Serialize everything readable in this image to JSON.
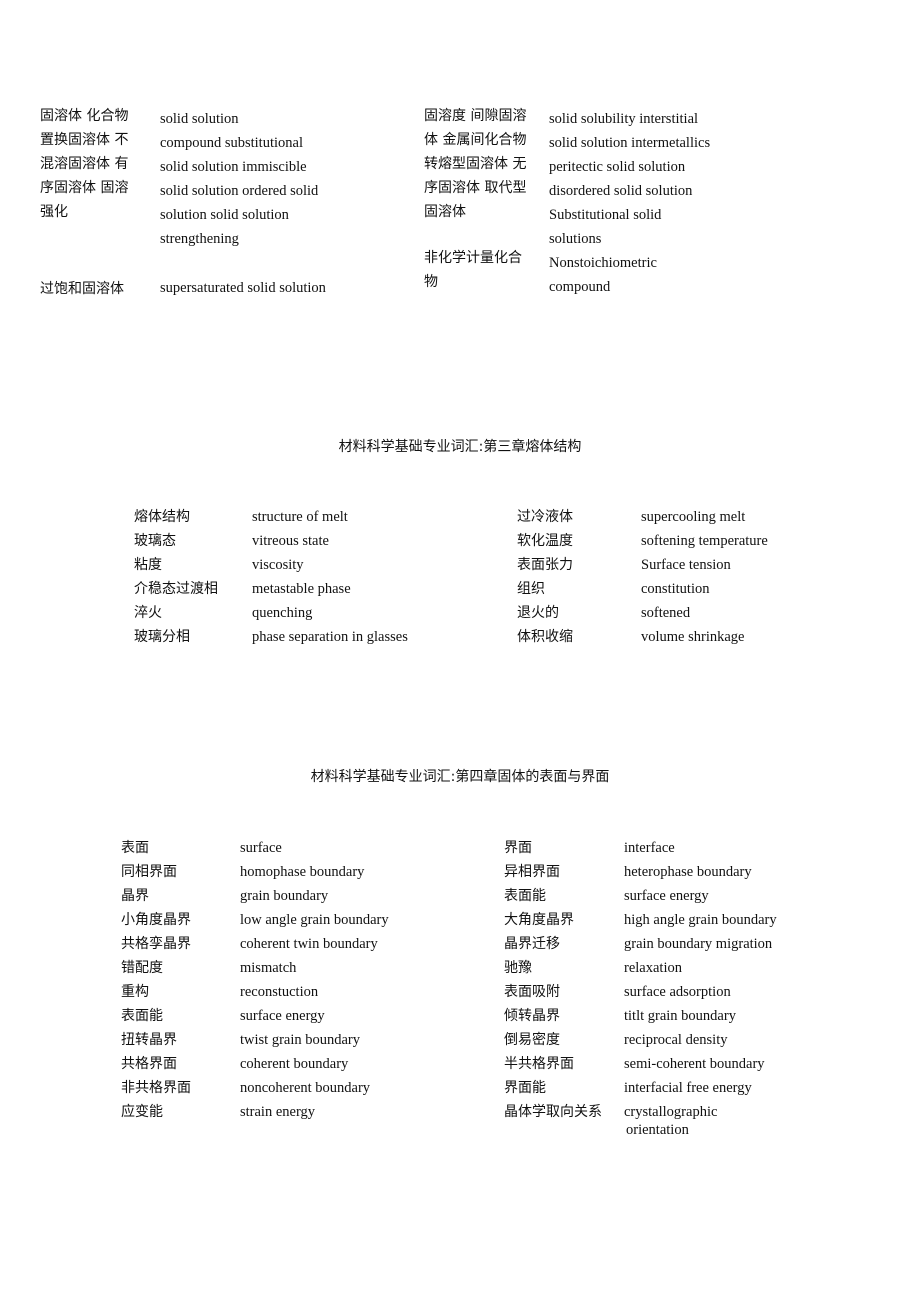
{
  "section2": {
    "left": {
      "zh_lines": [
        "固溶体  化合物",
        "置换固溶体  不",
        "混溶固溶体  有",
        "序固溶体  固溶",
        "强化"
      ],
      "en_lines": [
        "solid solution",
        "compound substitutional",
        "solid solution immiscible",
        "solid solution ordered solid",
        "solution solid solution",
        "strengthening"
      ],
      "extra_zh": "过饱和固溶体",
      "extra_en": "supersaturated solid solution"
    },
    "right": {
      "zh_lines": [
        "固溶度  间隙固溶",
        "体  金属间化合物",
        "转熔型固溶体  无",
        "序固溶体  取代型",
        "固溶体"
      ],
      "en_lines": [
        "solid solubility interstitial",
        "solid solution intermetallics",
        "peritectic solid solution",
        "disordered solid solution",
        "Substitutional solid",
        "solutions",
        "Nonstoichiometric",
        "compound"
      ],
      "extra_zh_lines": [
        "非化学计量化合",
        "物"
      ]
    }
  },
  "section3": {
    "title": "材料科学基础专业词汇:第三章熔体结构",
    "left": [
      {
        "zh": "熔体结构",
        "en": "structure of melt"
      },
      {
        "zh": "玻璃态",
        "en": "vitreous state"
      },
      {
        "zh": "粘度",
        "en": "viscosity"
      },
      {
        "zh": "介稳态过渡相",
        "en": "metastable phase"
      },
      {
        "zh": "淬火",
        "en": "quenching"
      },
      {
        "zh": "玻璃分相",
        "en": "phase separation in glasses"
      }
    ],
    "right": [
      {
        "zh": "过冷液体",
        "en": "supercooling melt"
      },
      {
        "zh": "软化温度",
        "en": "softening temperature"
      },
      {
        "zh": "表面张力",
        "en": "Surface tension"
      },
      {
        "zh": "组织",
        "en": "constitution"
      },
      {
        "zh": "退火的",
        "en": "softened"
      },
      {
        "zh": "体积收缩",
        "en": "volume shrinkage"
      }
    ]
  },
  "section4": {
    "title": "材料科学基础专业词汇:第四章固体的表面与界面",
    "left": [
      {
        "zh": "表面",
        "en": "surface"
      },
      {
        "zh": "同相界面",
        "en": "homophase boundary"
      },
      {
        "zh": "晶界",
        "en": "grain boundary"
      },
      {
        "zh": "小角度晶界",
        "en": "low angle grain boundary"
      },
      {
        "zh": "共格孪晶界",
        "en": "coherent twin boundary"
      },
      {
        "zh": "错配度",
        "en": "mismatch"
      },
      {
        "zh": "重构",
        "en": "reconstuction"
      },
      {
        "zh": "表面能",
        "en": "surface energy"
      },
      {
        "zh": "扭转晶界",
        "en": "twist grain boundary"
      },
      {
        "zh": "共格界面",
        "en": "coherent boundary"
      },
      {
        "zh": "非共格界面",
        "en": "noncoherent boundary"
      },
      {
        "zh": "应变能",
        "en": "strain energy"
      }
    ],
    "right": [
      {
        "zh": "界面",
        "en": "interface"
      },
      {
        "zh": "异相界面",
        "en": "heterophase boundary"
      },
      {
        "zh": "表面能",
        "en": "surface energy"
      },
      {
        "zh": "大角度晶界",
        "en": "high angle grain boundary"
      },
      {
        "zh": "晶界迁移",
        "en": "grain boundary migration"
      },
      {
        "zh": "驰豫",
        "en": "relaxation"
      },
      {
        "zh": "表面吸附",
        "en": "surface adsorption"
      },
      {
        "zh": "倾转晶界",
        "en": "titlt grain boundary"
      },
      {
        "zh": "倒易密度",
        "en": "reciprocal density"
      },
      {
        "zh": "半共格界面",
        "en": "semi-coherent boundary"
      },
      {
        "zh": "界面能",
        "en": "interfacial free energy"
      },
      {
        "zh": "晶体学取向关系",
        "en": "crystallographic",
        "en2": "orientation"
      }
    ]
  }
}
